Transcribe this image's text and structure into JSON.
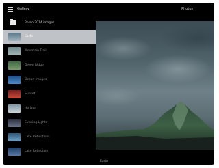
{
  "header": {
    "title": "Gallery",
    "action": "Photos"
  },
  "sidebar": {
    "header_label": "Photo 2014 images",
    "items": [
      {
        "label": "Earth",
        "colors": [
          "#5c7788",
          "#9fb3bf"
        ]
      },
      {
        "label": "Mountain Trail",
        "colors": [
          "#6f8a8c",
          "#a4b8b6"
        ]
      },
      {
        "label": "Green Ridge",
        "colors": [
          "#3f6a46",
          "#7a9b6d"
        ]
      },
      {
        "label": "Ocean Images",
        "colors": [
          "#1f4f8a",
          "#4d8bc9"
        ]
      },
      {
        "label": "Sunset",
        "colors": [
          "#7a1f1f",
          "#c94b3a"
        ]
      },
      {
        "label": "Horizon",
        "colors": [
          "#7f97a4",
          "#c9d3d8"
        ]
      },
      {
        "label": "Evening Lights",
        "colors": [
          "#2a2f3d",
          "#68728a"
        ]
      },
      {
        "label": "Lake Reflections",
        "colors": [
          "#2e5a7a",
          "#6fa0c4"
        ]
      },
      {
        "label": "Lake Reflection",
        "colors": [
          "#1e3f66",
          "#5679a6"
        ]
      }
    ]
  },
  "footer": {
    "label": "Earth"
  }
}
